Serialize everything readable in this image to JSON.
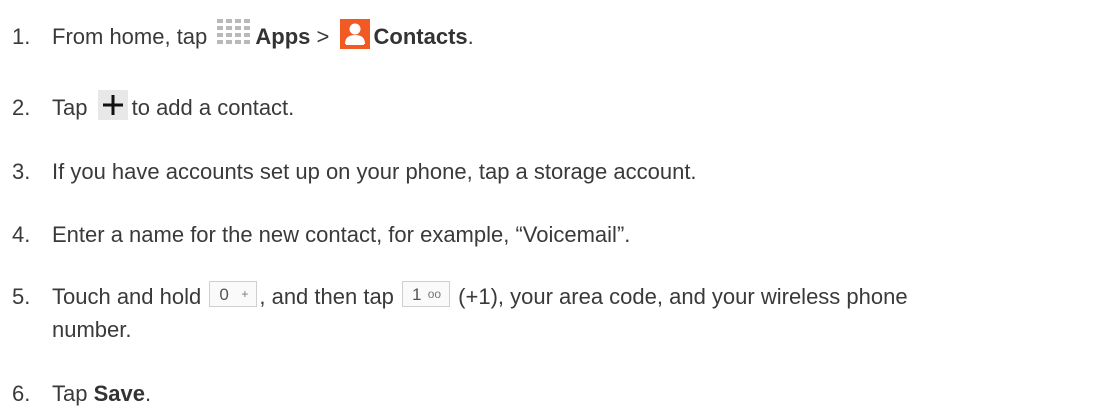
{
  "icons": [
    "apps-grid-icon",
    "contacts-person-icon",
    "plus-icon",
    "key-zero-icon",
    "key-one-icon"
  ],
  "colors": {
    "contacts_icon": "#f15a22",
    "apps_icon": "#b9b9b9",
    "text": "#3a3a3a"
  },
  "steps": [
    {
      "num": "1.",
      "a": "From home, tap",
      "b": "Apps",
      "c": ">",
      "d": "Contacts",
      "e": "."
    },
    {
      "num": "2.",
      "a": "Tap",
      "b": "to add a contact."
    },
    {
      "num": "3.",
      "a": "If you have accounts set up on your phone, tap a storage account."
    },
    {
      "num": "4.",
      "a": "Enter a name for the new contact, for example, “Voicemail”."
    },
    {
      "num": "5.",
      "a": "Touch and hold",
      "key0": "0",
      "key0_sub": "+",
      "b": ", and then tap",
      "key1": "1",
      "key1_sub": "oo",
      "c": "(+1), your area code, and your wireless phone",
      "d": "number."
    },
    {
      "num": "6.",
      "a": "Tap",
      "b": "Save",
      "c": "."
    }
  ]
}
